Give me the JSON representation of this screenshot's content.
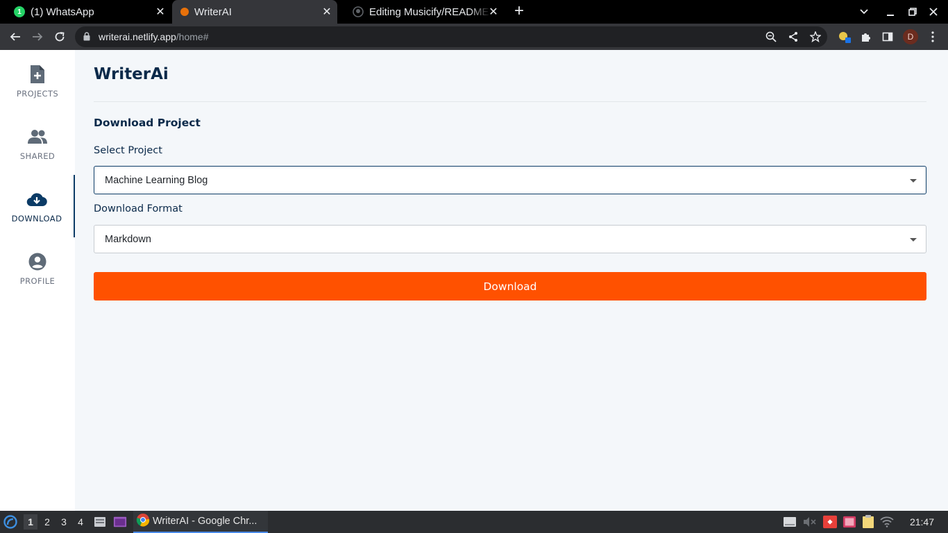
{
  "browser": {
    "tabs": [
      {
        "title": "(1) WhatsApp",
        "favicon": "whatsapp-icon",
        "favicon_color": "#25d366",
        "badge": "1"
      },
      {
        "title": "WriterAI",
        "favicon": "writerai-icon",
        "favicon_color": "#e8710a",
        "active": true
      },
      {
        "title": "Editing Musicify/README",
        "favicon": "github-icon",
        "favicon_color": "#5f6368"
      }
    ],
    "url_host": "writerai.netlify.app",
    "url_path": "/home#",
    "profile_initial": "D",
    "profile_color": "#6b2c1f"
  },
  "sidebar": {
    "items": [
      {
        "label": "PROJECTS",
        "icon": "file-plus-icon"
      },
      {
        "label": "SHARED",
        "icon": "users-icon"
      },
      {
        "label": "DOWNLOAD",
        "icon": "cloud-download-icon",
        "active": true
      },
      {
        "label": "PROFILE",
        "icon": "user-circle-icon"
      }
    ]
  },
  "main": {
    "app_title": "WriterAi",
    "section_heading": "Download Project",
    "select_project_label": "Select Project",
    "select_project_value": "Machine Learning Blog",
    "download_format_label": "Download Format",
    "download_format_value": "Markdown",
    "download_button": "Download"
  },
  "taskbar": {
    "workspaces": [
      "1",
      "2",
      "3",
      "4"
    ],
    "current_workspace": "1",
    "task_title": "WriterAI - Google Chr...",
    "clock": "21:47"
  },
  "colors": {
    "accent": "#ff5100",
    "navy": "#0b2a4a",
    "page_bg": "#f4f7fa"
  }
}
